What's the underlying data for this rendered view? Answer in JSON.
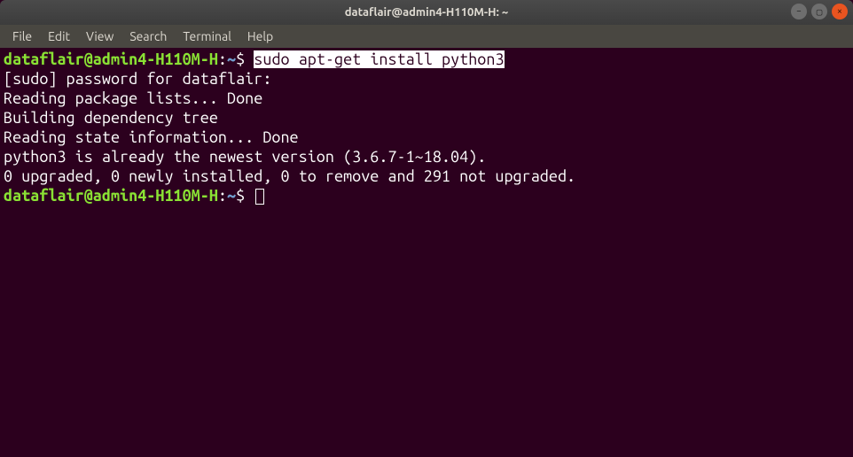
{
  "window": {
    "title": "dataflair@admin4-H110M-H: ~"
  },
  "menubar": {
    "items": [
      "File",
      "Edit",
      "View",
      "Search",
      "Terminal",
      "Help"
    ]
  },
  "terminal": {
    "prompt": {
      "user_host": "dataflair@admin4-H110M-H",
      "path": "~",
      "symbol": "$"
    },
    "command": "sudo apt-get install python3",
    "output_lines": [
      "[sudo] password for dataflair: ",
      "Reading package lists... Done",
      "Building dependency tree       ",
      "Reading state information... Done",
      "python3 is already the newest version (3.6.7-1~18.04).",
      "0 upgraded, 0 newly installed, 0 to remove and 291 not upgraded."
    ]
  },
  "window_controls": {
    "minimize": "–",
    "maximize": "▢",
    "close": "×"
  }
}
